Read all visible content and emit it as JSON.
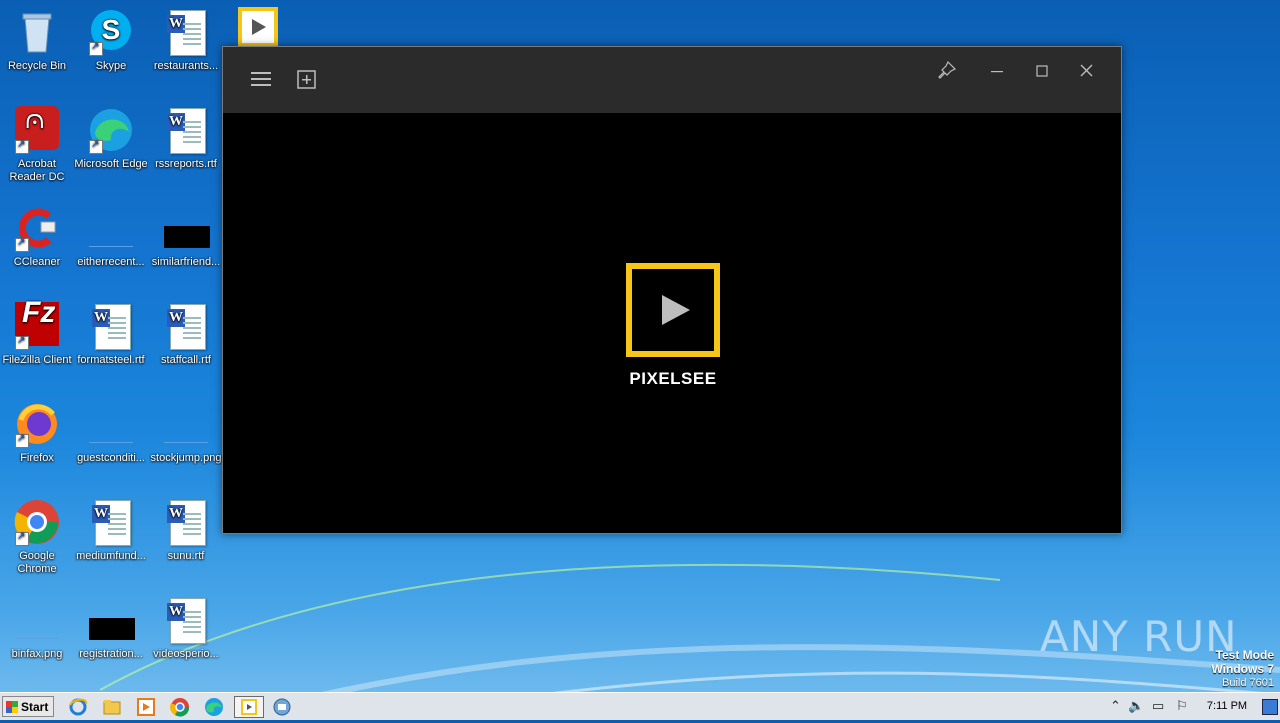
{
  "desktop": {
    "icons": [
      {
        "label": "Recycle Bin"
      },
      {
        "label": "Skype"
      },
      {
        "label": "restaurants..."
      },
      {
        "label": "Acrobat Reader DC"
      },
      {
        "label": "Microsoft Edge"
      },
      {
        "label": "rssreports.rtf"
      },
      {
        "label": "CCleaner"
      },
      {
        "label": "eitherrecent..."
      },
      {
        "label": "similarfriend..."
      },
      {
        "label": "FileZilla Client"
      },
      {
        "label": "formatsteel.rtf"
      },
      {
        "label": "staffcall.rtf"
      },
      {
        "label": "Firefox"
      },
      {
        "label": "guestconditi..."
      },
      {
        "label": "stockjump.png"
      },
      {
        "label": "Google Chrome"
      },
      {
        "label": "mediumfund..."
      },
      {
        "label": "sunu.rtf"
      },
      {
        "label": "binfax.png"
      },
      {
        "label": "registration..."
      },
      {
        "label": "videosperio..."
      }
    ]
  },
  "app": {
    "logo_text": "PIXELSEE",
    "accent": "#f5c518",
    "titlebar_icons": [
      "hamburger-menu-icon",
      "add-media-icon",
      "pin-icon",
      "minimize-icon",
      "maximize-icon",
      "close-icon"
    ]
  },
  "watermark": {
    "text": "ANY RUN"
  },
  "test_mode": {
    "line1": "Test Mode",
    "line2": "Windows 7",
    "line3": "Build 7601"
  },
  "taskbar": {
    "start_label": "Start",
    "clock": "7:11 PM"
  }
}
